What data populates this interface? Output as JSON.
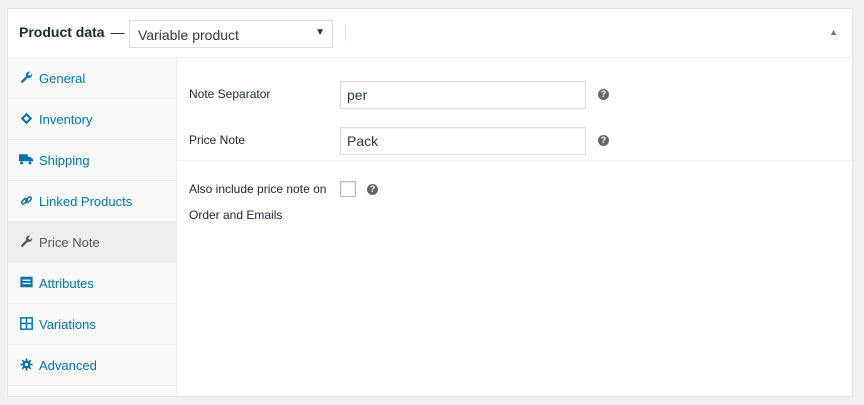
{
  "header": {
    "title": "Product data",
    "dash": "—",
    "product_type": "Variable product",
    "select_arrow": "▼",
    "toggle_icon": "▲"
  },
  "tabs": [
    {
      "label": "General",
      "icon": "wrench-icon"
    },
    {
      "label": "Inventory",
      "icon": "tag-icon"
    },
    {
      "label": "Shipping",
      "icon": "truck-icon"
    },
    {
      "label": "Linked Products",
      "icon": "link-icon"
    },
    {
      "label": "Price Note",
      "icon": "wrench-icon",
      "active": true
    },
    {
      "label": "Attributes",
      "icon": "list-icon"
    },
    {
      "label": "Variations",
      "icon": "grid-icon"
    },
    {
      "label": "Advanced",
      "icon": "gear-icon"
    }
  ],
  "fields": {
    "note_separator": {
      "label": "Note Separator",
      "value": "per"
    },
    "price_note": {
      "label": "Price Note",
      "value": "Pack"
    },
    "include_note": {
      "label_line1": "Also include price note on",
      "label_line2": "Order and Emails",
      "checked": false
    }
  },
  "help_glyph": "?",
  "colors": {
    "link": "#0073aa",
    "active_tab_bg": "#eeeeee",
    "help_icon": "#666666"
  }
}
